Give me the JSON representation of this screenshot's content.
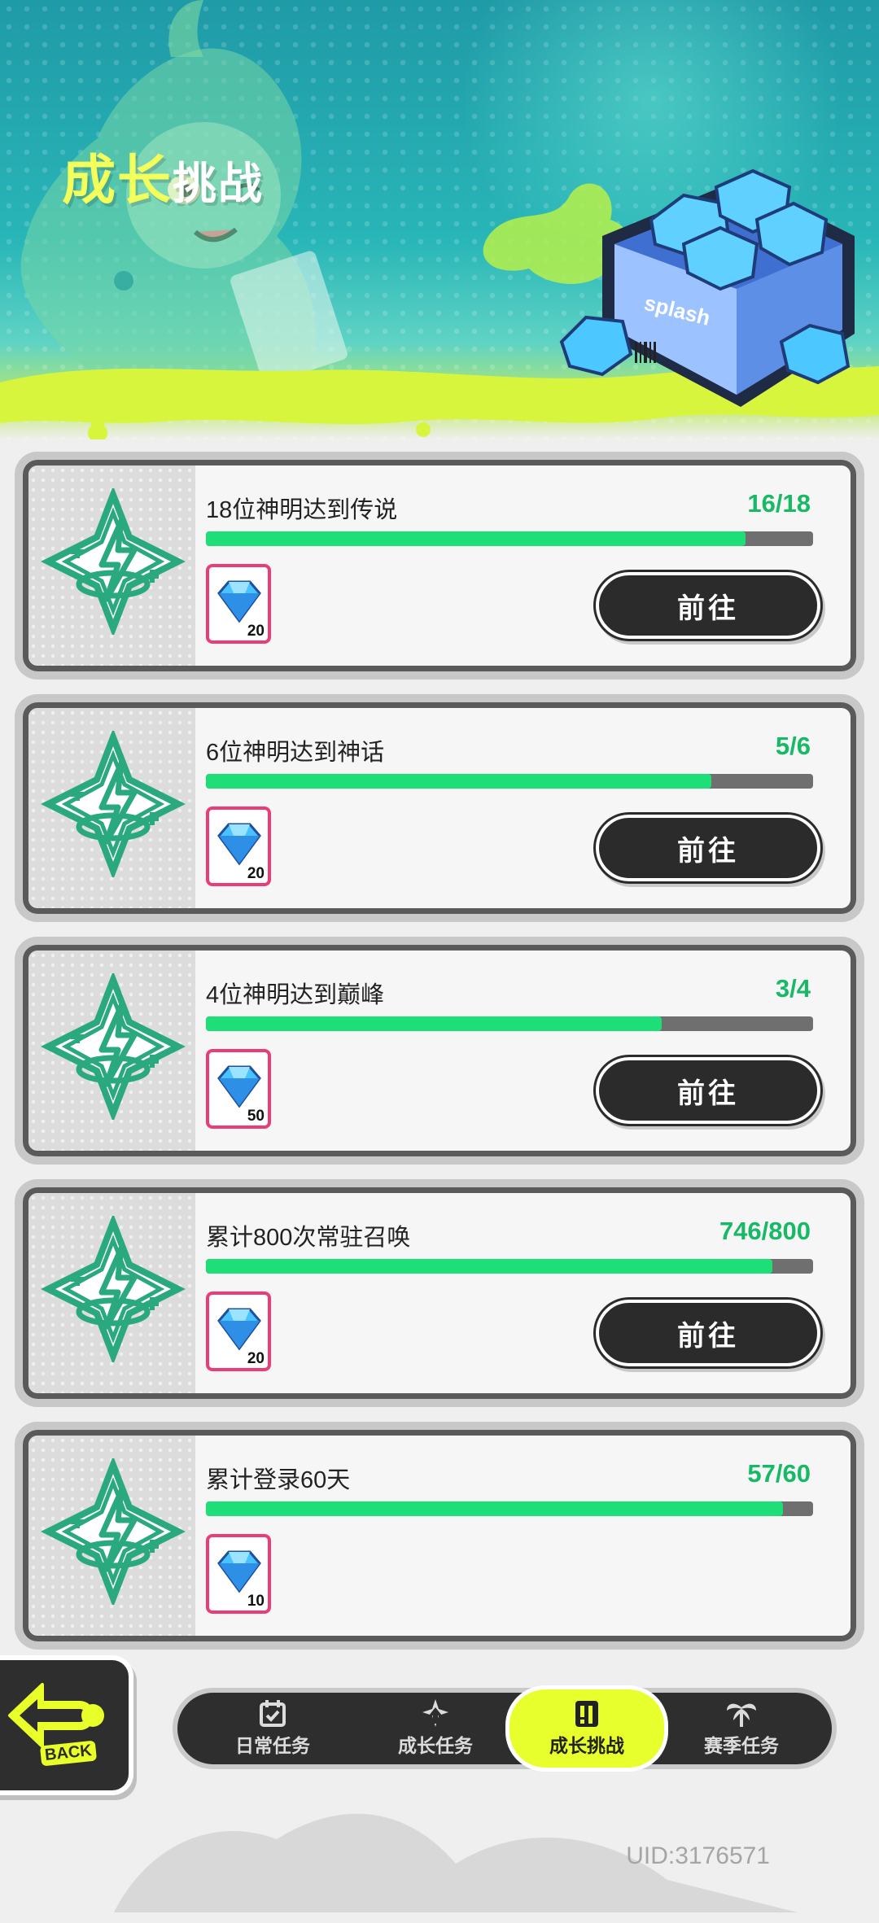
{
  "header": {
    "title_big": "成长",
    "title_small": "挑战",
    "box_brand": "splash"
  },
  "tasks": [
    {
      "name": "18位神明达到传说",
      "progress_text": "16/18",
      "progress": 0.889,
      "reward_count": "20",
      "button_label": "前往"
    },
    {
      "name": "6位神明达到神话",
      "progress_text": "5/6",
      "progress": 0.833,
      "reward_count": "20",
      "button_label": "前往"
    },
    {
      "name": "4位神明达到巅峰",
      "progress_text": "3/4",
      "progress": 0.75,
      "reward_count": "50",
      "button_label": "前往"
    },
    {
      "name": "累计800次常驻召唤",
      "progress_text": "746/800",
      "progress": 0.9325,
      "reward_count": "20",
      "button_label": "前往"
    },
    {
      "name": "累计登录60天",
      "progress_text": "57/60",
      "progress": 0.95,
      "reward_count": "10",
      "button_label": ""
    }
  ],
  "back_button": {
    "label": "BACK"
  },
  "tabs": [
    {
      "label": "日常任务",
      "icon": "calendar-check-icon",
      "active": false
    },
    {
      "label": "成长任务",
      "icon": "sparkle-arrow-icon",
      "active": false
    },
    {
      "label": "成长挑战",
      "icon": "exclamation-badge-icon",
      "active": true
    },
    {
      "label": "赛季任务",
      "icon": "palm-tree-icon",
      "active": false
    }
  ],
  "footer": {
    "uid": "UID:3176571"
  },
  "colors": {
    "accent_green": "#1ede77",
    "progress_text": "#17b967",
    "highlight_yellow": "#e7ff2c",
    "reward_border": "#ea3c78",
    "dark": "#2b2b2b"
  }
}
